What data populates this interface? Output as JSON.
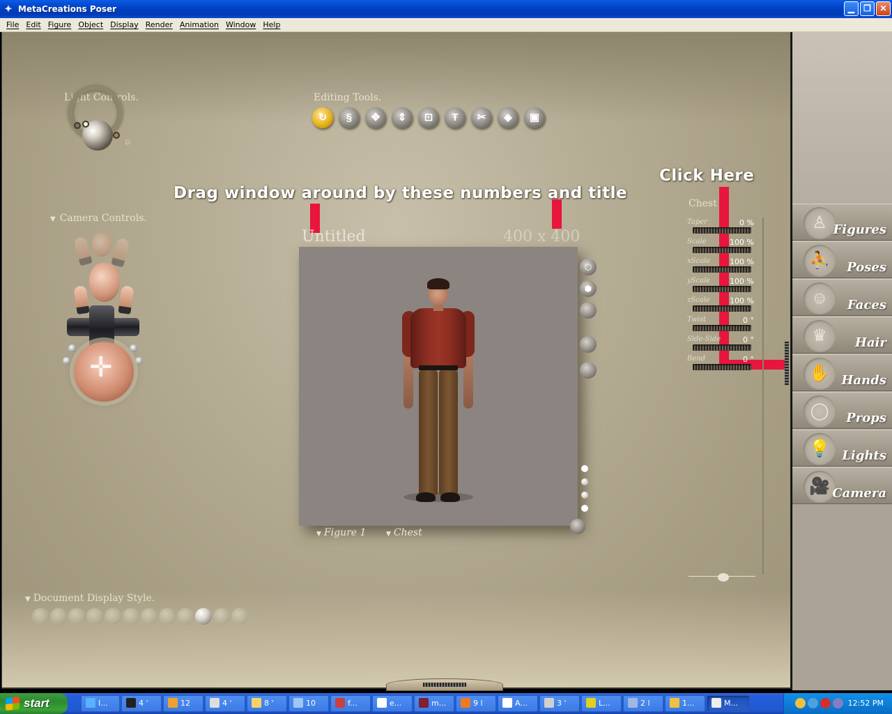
{
  "window": {
    "title": "MetaCreations Poser"
  },
  "menu": [
    "File",
    "Edit",
    "Figure",
    "Object",
    "Display",
    "Render",
    "Animation",
    "Window",
    "Help"
  ],
  "light_controls": {
    "label": "Light Controls."
  },
  "editing_tools": {
    "label": "Editing Tools.",
    "tools": [
      "rotate",
      "twist",
      "translate",
      "translate-in-out",
      "scale",
      "taper",
      "chain-break",
      "color",
      "direct-manipulation"
    ],
    "active": "rotate"
  },
  "camera_controls": {
    "label": "Camera Controls."
  },
  "annotations": {
    "drag": "Drag window around by these numbers and title",
    "click": "Click Here"
  },
  "document": {
    "title": "Untitled",
    "size": "400 x 400",
    "figure_menu": "Figure 1",
    "part_menu": "Chest"
  },
  "parameters": {
    "part": "Chest",
    "dials": [
      {
        "name": "Taper",
        "value": "0 %"
      },
      {
        "name": "Scale",
        "value": "100 %"
      },
      {
        "name": "xScale",
        "value": "100 %"
      },
      {
        "name": "yScale",
        "value": "100 %"
      },
      {
        "name": "zScale",
        "value": "100 %"
      },
      {
        "name": "Twist",
        "value": "0 °"
      },
      {
        "name": "Side-Side",
        "value": "0 °"
      },
      {
        "name": "Bend",
        "value": "0 °"
      }
    ]
  },
  "display_style": {
    "label": "Document Display Style."
  },
  "library": [
    "Figures",
    "Poses",
    "Faces",
    "Hair",
    "Hands",
    "Props",
    "Lights",
    "Camera"
  ],
  "taskbar": {
    "start": "start",
    "tasks": [
      "I...",
      "4 '",
      "12",
      "4 '",
      "8 '",
      "10",
      "f...",
      "e...",
      "m...",
      "9 l",
      "A...",
      "3 '",
      "L...",
      "2 l",
      "1...",
      "M..."
    ],
    "clock": "12:52 PM"
  }
}
